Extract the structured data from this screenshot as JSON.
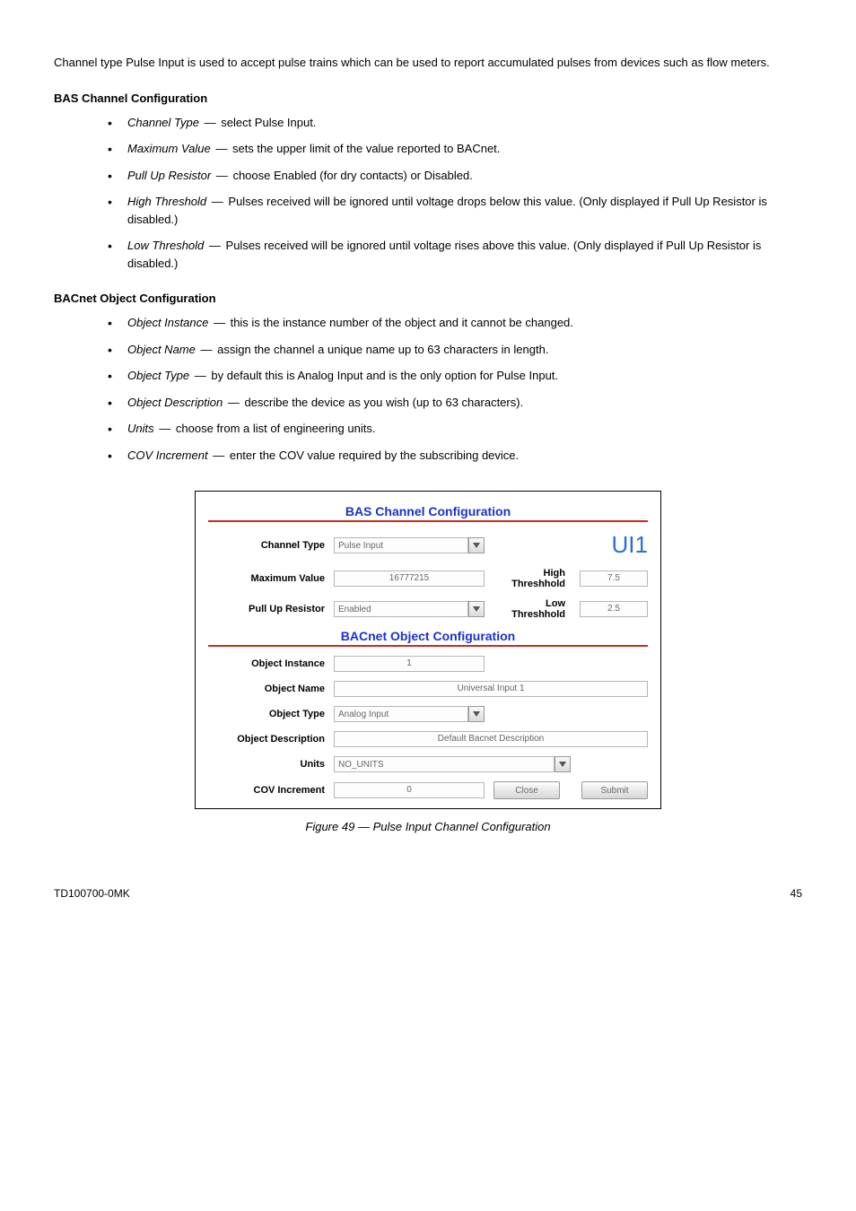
{
  "intro": "Channel type Pulse Input is used to accept pulse trains which can be used to report accumulated pulses from devices such as flow meters.",
  "bas": {
    "title": "BAS Channel Configuration",
    "bullets": [
      {
        "term": "Channel Type",
        "text": "select Pulse Input."
      },
      {
        "term": "Maximum Value",
        "text": "sets the upper limit of the value reported to BACnet."
      },
      {
        "term": "Pull Up Resistor",
        "text": "choose Enabled (for dry contacts) or Disabled."
      },
      {
        "term": "High Threshold",
        "text": "Pulses received will be ignored until voltage drops below this value. (Only displayed if Pull Up Resistor is disabled.)"
      },
      {
        "term": "Low Threshold",
        "text": "Pulses received will be ignored until voltage rises above this value. (Only displayed if Pull Up Resistor is disabled.)"
      }
    ]
  },
  "bacnet": {
    "title": "BACnet Object Configuration",
    "bullets": [
      {
        "term": "Object Instance",
        "text": "this is the instance number of the object and it cannot be changed."
      },
      {
        "term": "Object Name",
        "text": "assign the channel a unique name up to 63 characters in length."
      },
      {
        "term": "Object Type",
        "text": "by default this is Analog Input and is the only option for Pulse Input."
      },
      {
        "term": "Object Description",
        "text": "describe the device as you wish (up to 63 characters)."
      },
      {
        "term": "Units",
        "text": "choose from a list of engineering units."
      },
      {
        "term": "COV Increment",
        "text": "enter the COV value required by the subscribing device."
      }
    ]
  },
  "dialog": {
    "header1": "BAS Channel Configuration",
    "header2": "BACnet Object Configuration",
    "ui": "UI1",
    "channel_type_lbl": "Channel Type",
    "channel_type_val": "Pulse Input",
    "max_value_lbl": "Maximum Value",
    "max_value_val": "16777215",
    "high_thresh_lbl": "High Threshhold",
    "high_thresh_val": "7.5",
    "pull_up_lbl": "Pull Up Resistor",
    "pull_up_val": "Enabled",
    "low_thresh_lbl": "Low Threshhold",
    "low_thresh_val": "2.5",
    "obj_instance_lbl": "Object Instance",
    "obj_instance_val": "1",
    "obj_name_lbl": "Object Name",
    "obj_name_val": "Universal Input 1",
    "obj_type_lbl": "Object Type",
    "obj_type_val": "Analog Input",
    "obj_desc_lbl": "Object Description",
    "obj_desc_val": "Default Bacnet Description",
    "units_lbl": "Units",
    "units_val": "NO_UNITS",
    "cov_lbl": "COV Increment",
    "cov_val": "0",
    "close": "Close",
    "submit": "Submit"
  },
  "caption_label": "Figure 49 —",
  "caption_text": "Pulse Input Channel Configuration",
  "footer_left": "TD100700-0MK",
  "footer_right": "45"
}
